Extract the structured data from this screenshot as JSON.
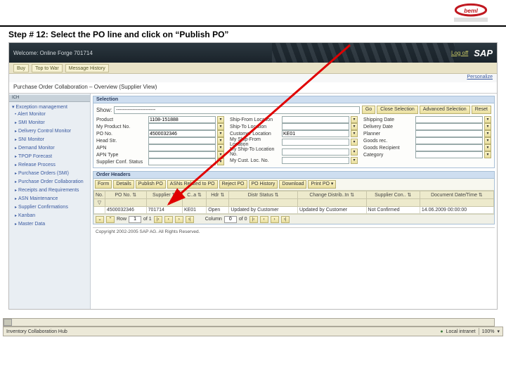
{
  "step": {
    "prefix": "Step # 12:  ",
    "text": "Select the PO line and click on ",
    "emphasis": "“Publish PO”"
  },
  "logo_label": "BEML",
  "shell": {
    "welcome": "Welcome: Online Forge 701714",
    "logoff": "Log off",
    "sap": "SAP"
  },
  "tabs": {
    "t1": "Buy",
    "t2": "Top to War",
    "t3": "Message History"
  },
  "personalize": "Personalize",
  "page_title": "Purchase Order Collaboration – Overview (Supplier View)",
  "nav": {
    "handle": "ICH",
    "heading": "▾ Exception management",
    "items": [
      "Alert Monitor",
      "SMI Monitor",
      "Delivery Control Monitor",
      "SNI Monitor",
      "Demand Monitor",
      "TPOP Forecast",
      "Release Process",
      "Purchase Orders (SMI)",
      "Purchase Order Collaboration",
      "Receipts and Requirements",
      "ASN Maintenance",
      "Supplier Confirmations",
      "Kanban",
      "Master Data"
    ]
  },
  "selection": {
    "title": "Selection",
    "show_label": "Show:",
    "show_value": "------------------------",
    "buttons": {
      "go": "Go",
      "close": "Close Selection",
      "advanced": "Advanced Selection",
      "reset": "Reset"
    },
    "col1": [
      {
        "label": "Product",
        "value": "1108-151888"
      },
      {
        "label": "My Product No.",
        "value": ""
      },
      {
        "label": "PO No.",
        "value": "4500032346"
      },
      {
        "label": "Head Str.",
        "value": ""
      },
      {
        "label": "APN",
        "value": ""
      },
      {
        "label": "APN Type",
        "value": ""
      },
      {
        "label": "Supplier Conf. Status",
        "value": ""
      }
    ],
    "col2": [
      {
        "label": "Ship-From Location",
        "value": ""
      },
      {
        "label": "Ship-To Location",
        "value": ""
      },
      {
        "label": "Customer Location",
        "value": "KE01"
      },
      {
        "label": "My Ship-From Location",
        "value": ""
      },
      {
        "label": "My Ship-To Location No.",
        "value": ""
      },
      {
        "label": "My Cust. Loc. No.",
        "value": ""
      }
    ],
    "col3": [
      {
        "label": "Shipping Date",
        "value": ""
      },
      {
        "label": "Delivery Date",
        "value": ""
      },
      {
        "label": "Planner",
        "value": ""
      },
      {
        "label": "Goods rec.",
        "value": ""
      },
      {
        "label": "Goods Recipient",
        "value": ""
      },
      {
        "label": "Category",
        "value": ""
      }
    ]
  },
  "orders": {
    "title": "Order Headers",
    "toolbar": [
      "Form",
      "Details",
      "Publish PO",
      "ASNs Related to PO",
      "Reject PO",
      "PO History",
      "Download",
      "Print PO ▾"
    ],
    "columns": [
      "No.",
      "PO No. ⇅",
      "Supplier ⇅",
      "C..a ⇅",
      "Hdr ⇅",
      "Distr Status ⇅",
      "Change Distrib..tn ⇅",
      "Supplier Con.. ⇅",
      "Document Date/Time ⇅"
    ],
    "row": [
      "",
      "4500032346",
      "701714",
      "KE01",
      "Open",
      "Updated by Customer",
      "Updated by Customer",
      "Not Confirmed",
      "14.06.2009 00:00:00"
    ],
    "pager": {
      "exp": "⌄",
      "collapse": "⌃",
      "row_label": "Row",
      "row_cur": "1",
      "row_tot": "of 1",
      "col_label": "Column",
      "col_cur": "0",
      "col_tot": "of 0"
    }
  },
  "copyright": "Copyright 2002-2005 SAP AG. All Rights Reserved.",
  "status": {
    "left": "Inventory Collaboration Hub",
    "zone": "Local intranet",
    "zoom": "100%"
  }
}
